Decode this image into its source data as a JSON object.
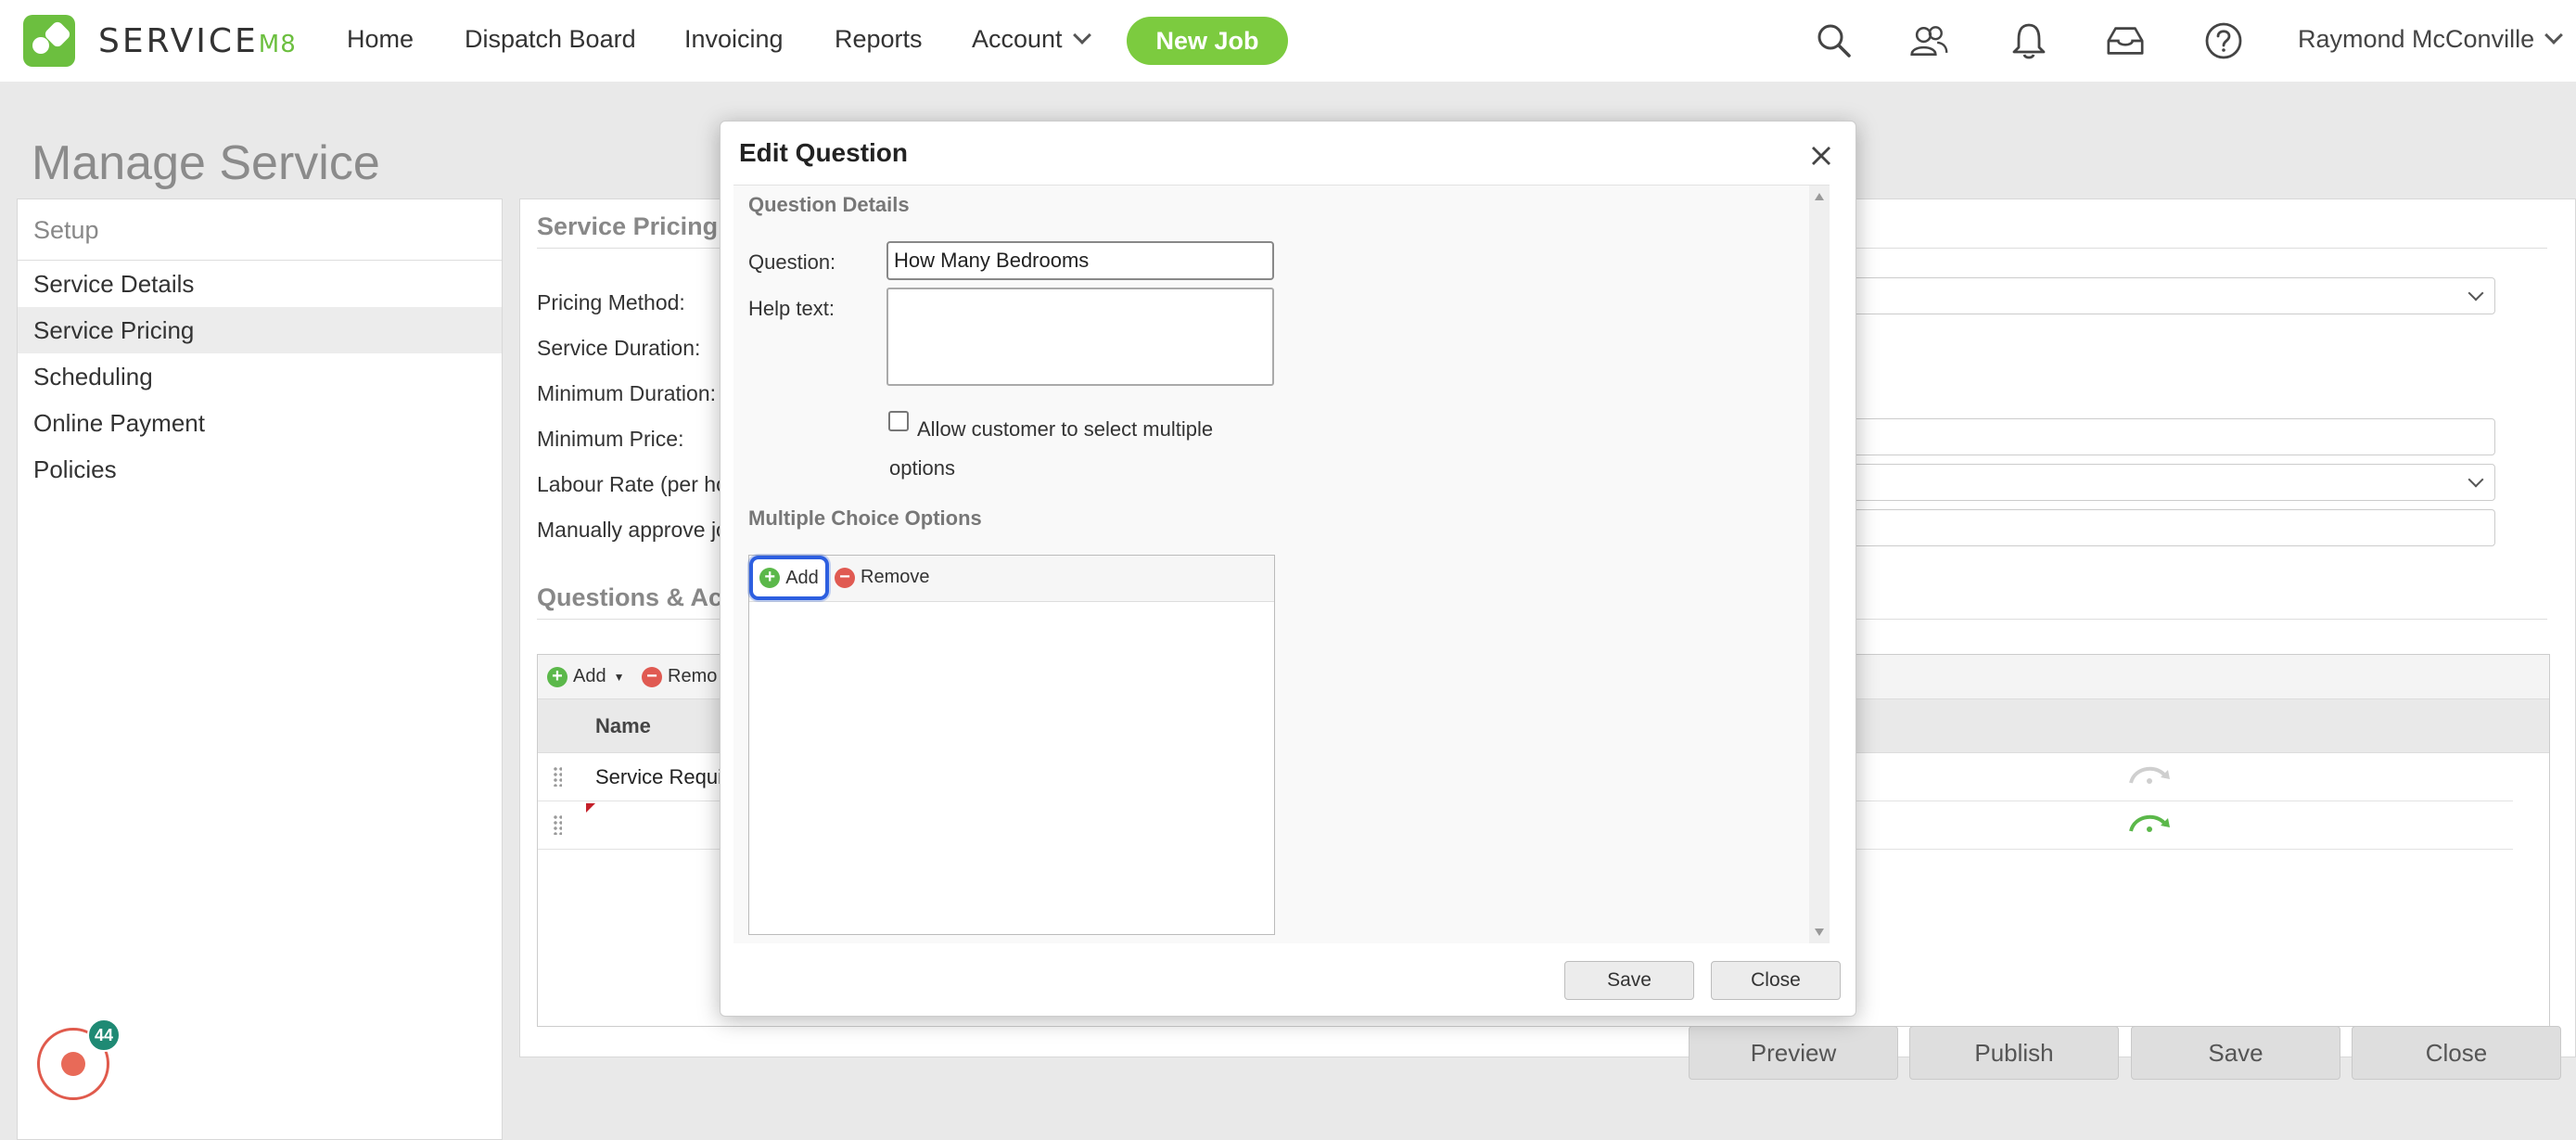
{
  "header": {
    "logo_text": "SERVICE",
    "logo_suffix": "M8",
    "nav": [
      "Home",
      "Dispatch Board",
      "Invoicing",
      "Reports",
      "Account"
    ],
    "new_job_label": "New Job",
    "user_name": "Raymond McConville",
    "icons": [
      "search-icon",
      "people-icon",
      "bell-icon",
      "inbox-icon",
      "help-icon"
    ]
  },
  "page": {
    "title": "Manage Service",
    "sidebar": {
      "heading": "Setup",
      "items": [
        "Service Details",
        "Service Pricing",
        "Scheduling",
        "Online Payment",
        "Policies"
      ],
      "active": "Service Pricing"
    },
    "pricing": {
      "title": "Service Pricing",
      "labels": [
        "Pricing Method:",
        "Service Duration:",
        "Minimum Duration:",
        "Minimum Price:",
        "Labour Rate (per hou",
        "Manually approve jo"
      ]
    },
    "questions": {
      "title": "Questions & Acti",
      "add_label": "Add",
      "remove_label": "Remo",
      "column_name": "Name",
      "rows": [
        "Service Requi",
        ""
      ]
    },
    "footer_buttons": [
      "Preview",
      "Publish",
      "Save",
      "Close"
    ],
    "chat_badge": "44"
  },
  "dialog": {
    "title": "Edit Question",
    "section_details": "Question Details",
    "question_label": "Question:",
    "question_value": "How Many Bedrooms",
    "help_label": "Help text:",
    "help_value": "",
    "multi_select_label": "Allow customer to select multiple options",
    "multi_select_checked": false,
    "section_options": "Multiple Choice Options",
    "add_label": "Add",
    "remove_label": "Remove",
    "save_label": "Save",
    "close_label": "Close"
  },
  "colors": {
    "brand_green": "#7ccb3f",
    "focus_blue": "#2d5fe0",
    "remove_red": "#e05a52"
  }
}
